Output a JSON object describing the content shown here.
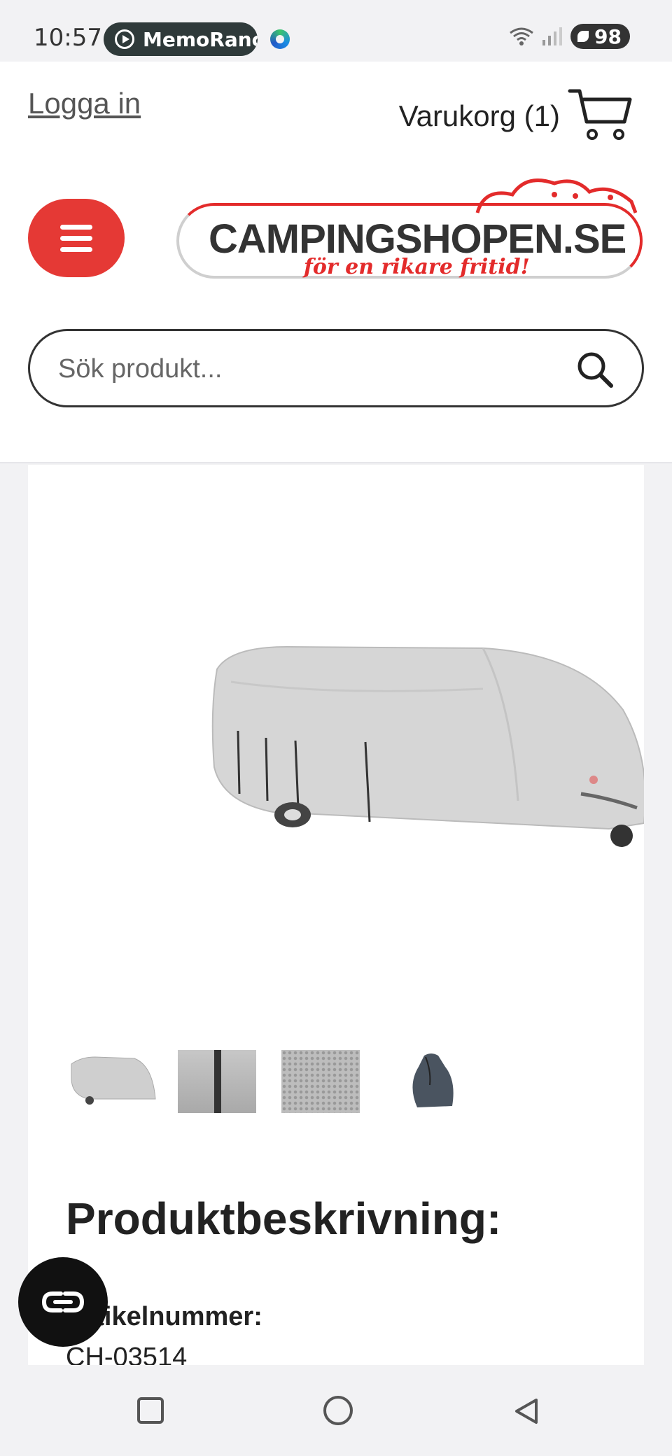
{
  "status_bar": {
    "time": "10:57",
    "app_pill": "MemoRanc",
    "battery": "98",
    "icons": [
      "play-icon",
      "edge-browser-icon",
      "wifi-icon",
      "signal-icon",
      "battery-icon"
    ]
  },
  "header": {
    "login_label": "Logga in",
    "cart_label": "Varukorg (1)",
    "logo_main": "CAMPINGSHOPEN.SE",
    "logo_tagline": "för en rikare fritid!",
    "search_placeholder": "Sök produkt..."
  },
  "product": {
    "image_alt": "caravan-cover-product-image",
    "thumbnails": [
      "caravan-cover-thumbnail",
      "strap-closeup-thumbnail",
      "fabric-texture-thumbnail",
      "storage-bag-thumbnail"
    ],
    "section_title": "Produktbeskrivning:",
    "article_label": "Artikelnummer:",
    "article_number": "CH-03514"
  },
  "colors": {
    "accent": "#e53935",
    "text": "#222222",
    "background": "#f2f2f4"
  }
}
